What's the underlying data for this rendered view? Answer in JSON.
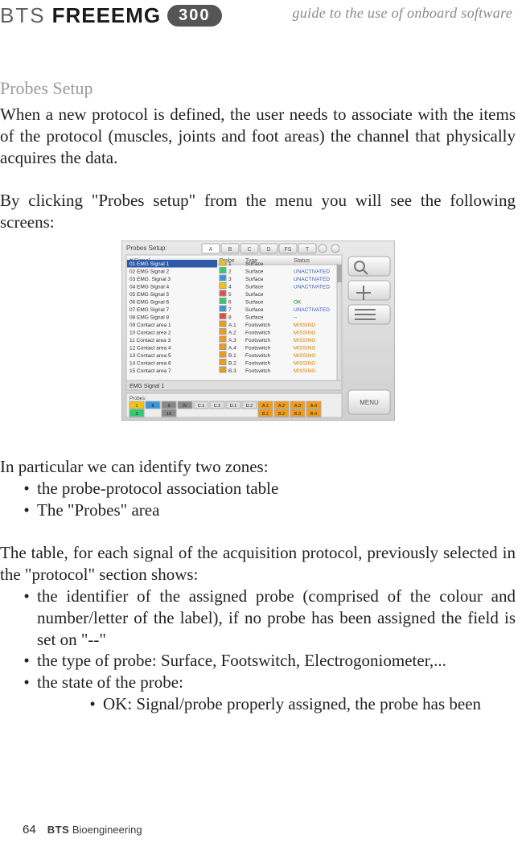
{
  "header": {
    "brand_bts": "BTS",
    "brand_freeemg": "FREEEMG",
    "brand_badge": "300",
    "tagline": "guide to the use of onboard software"
  },
  "section_title": "Probes Setup",
  "para1": "When a new protocol is defined, the user needs to associate with the items of the protocol (muscles, joints and foot areas) the channel that physically acquires the data.",
  "para2": "By clicking \"Probes setup\" from the menu you will see the following screens:",
  "para3": "In particular we can identify two zones:",
  "bullets1": {
    "a": "the probe-protocol association table",
    "b": "The \"Probes\" area"
  },
  "para4": "The table, for each signal of the acquisition protocol, previously selected in the \"protocol\" section shows:",
  "bullets2": {
    "a": "the identifier of the assigned probe (comprised of the colour and number/letter of the label), if no probe has been assigned the field is set on \"--\"",
    "b": "the type of probe: Surface, Footswitch, Electrogoniometer,...",
    "c": "the state of the probe:"
  },
  "bullets3": {
    "a": "OK: Signal/probe properly assigned, the probe has been"
  },
  "footer": {
    "page": "64",
    "brand_bold": "BTS",
    "brand_rest": "Bioengineering"
  },
  "shot": {
    "title": "Probes Setup:",
    "tabs": [
      "A",
      "B",
      "C",
      "D",
      "FS",
      "T"
    ],
    "columns": [
      "# Signal",
      "Probe",
      "Type",
      "Status"
    ],
    "rows": [
      {
        "n": "01",
        "sig": "EMG Signal 1",
        "probe": "1",
        "ptype": "Surface",
        "status": "",
        "hl": true,
        "color": "#f1c40f"
      },
      {
        "n": "02",
        "sig": "EMG Signal 2",
        "probe": "2",
        "ptype": "Surface",
        "status": "UNACTIVATED",
        "color": "#2ecc71"
      },
      {
        "n": "03",
        "sig": "EMG. Signal 3",
        "probe": "3",
        "ptype": "Surface",
        "status": "UNACTIVATED",
        "color": "#3498db"
      },
      {
        "n": "04",
        "sig": "EMG Signal 4",
        "probe": "4",
        "ptype": "Surface",
        "status": "UNACTIVATED",
        "color": "#f1c40f"
      },
      {
        "n": "05",
        "sig": "EMG Signal 5",
        "probe": "5",
        "ptype": "Surface",
        "status": "",
        "color": "#e74c3c"
      },
      {
        "n": "06",
        "sig": "EMG Signal 6",
        "probe": "6",
        "ptype": "Surface",
        "status": "OK",
        "color": "#2ecc71"
      },
      {
        "n": "07",
        "sig": "EMG Signal 7",
        "probe": "7",
        "ptype": "Surface",
        "status": "UNACTIVATED",
        "color": "#3498db"
      },
      {
        "n": "08",
        "sig": "EMG Signal 8",
        "probe": "8",
        "ptype": "Surface",
        "status": "--",
        "color": "#e74c3c"
      },
      {
        "n": "09",
        "sig": "Contact area 1",
        "probe": "A.1",
        "ptype": "Footswitch",
        "status": "MISSING",
        "color": "#f39c12"
      },
      {
        "n": "10",
        "sig": "Contact area 2",
        "probe": "A.2",
        "ptype": "Footswitch",
        "status": "MISSING",
        "color": "#f39c12"
      },
      {
        "n": "11",
        "sig": "Contact area 3",
        "probe": "A.3",
        "ptype": "Footswitch",
        "status": "MISSING",
        "color": "#f39c12"
      },
      {
        "n": "12",
        "sig": "Contact area 4",
        "probe": "A.4",
        "ptype": "Footswitch",
        "status": "MISSING",
        "color": "#f39c12"
      },
      {
        "n": "13",
        "sig": "Contact area 5",
        "probe": "B.1",
        "ptype": "Footswitch",
        "status": "MISSING",
        "color": "#f39c12"
      },
      {
        "n": "14",
        "sig": "Contact area 6",
        "probe": "B.2",
        "ptype": "Footswitch",
        "status": "MISSING",
        "color": "#f39c12"
      },
      {
        "n": "15",
        "sig": "Contact area 7",
        "probe": "B.3",
        "ptype": "Footswitch",
        "status": "MISSING",
        "color": "#f39c12"
      }
    ],
    "selected": "EMG Signal 1",
    "probes_label": "Probes:",
    "probe_cells_top": [
      "1",
      "8",
      "9",
      "IV",
      "C.1",
      "C.2",
      "D.1",
      "D.2",
      "A.1",
      "A.2",
      "A.3",
      "A.4"
    ],
    "probe_cells_bot": [
      "3",
      "",
      "16",
      "",
      "",
      "",
      "",
      "",
      "B.1",
      "B.2",
      "B.3",
      "B.4"
    ],
    "menu_label": "MENU"
  }
}
